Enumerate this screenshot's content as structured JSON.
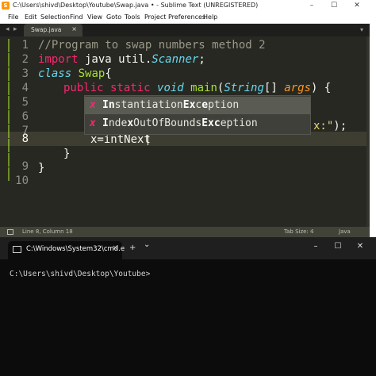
{
  "sublime": {
    "title": "C:\\Users\\shivd\\Desktop\\Youtube\\Swap.java • - Sublime Text (UNREGISTERED)",
    "app_icon_letter": "S",
    "menu": [
      "File",
      "Edit",
      "Selection",
      "Find",
      "View",
      "Goto",
      "Tools",
      "Project",
      "Preferences",
      "Help"
    ],
    "tab": {
      "label": "Swap.java",
      "close": "×"
    },
    "line_numbers": [
      "1",
      "2",
      "3",
      "4",
      "5",
      "6",
      "7",
      "8",
      "9",
      "10"
    ],
    "code": {
      "l1_comment": "//Program to swap numbers method 2",
      "l2_import": "import",
      "l2_pkg": " java util.",
      "l2_class": "Scanner",
      "l2_semi": ";",
      "l3_class_kw": "class",
      "l3_name": " Swap",
      "l3_brace": "{",
      "l4_public": "public",
      "l4_static": " static",
      "l4_void": " void",
      "l4_main": " main",
      "l4_paren": "(",
      "l4_type": "String",
      "l4_brackets": "[] ",
      "l4_args": "args",
      "l4_close": ") {",
      "l7_tail_str": "x:\"",
      "l7_tail_end": ");",
      "l8_code": "x=intNext",
      "l9_brace": "}",
      "l10_brace": "}"
    },
    "autocomplete": [
      {
        "kind": "x",
        "pre": "",
        "b1": "In",
        "mid1": "stantiation",
        "b2": "Ex",
        "mid2": "c",
        "b3": "e",
        "post": "ption"
      },
      {
        "kind": "x",
        "pre": "",
        "b1": "I",
        "mid1": "nde",
        "b2": "x",
        "mid2": "OutOfBounds",
        "b3": "Exc",
        "post": "eption"
      }
    ],
    "status": {
      "position": "Line 8, Column 18",
      "tab_size": "Tab Size: 4",
      "syntax": "Java"
    }
  },
  "terminal": {
    "tab_label": "C:\\Windows\\System32\\cmd.e",
    "tab_close": "×",
    "new_tab": "+",
    "dropdown": "⌄",
    "prompt": "C:\\Users\\shivd\\Desktop\\Youtube>"
  }
}
